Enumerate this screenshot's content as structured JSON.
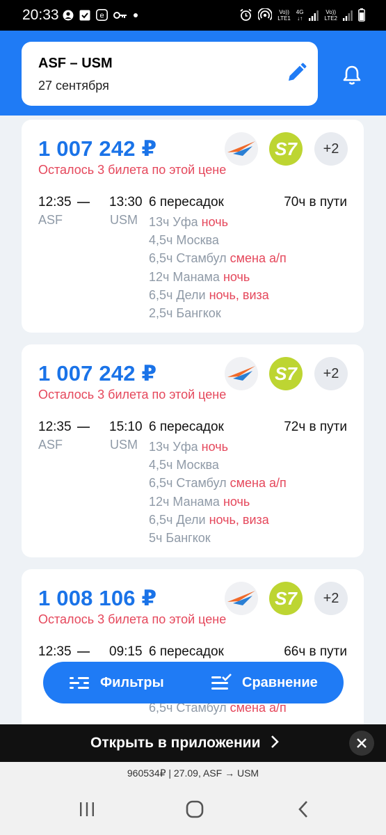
{
  "status_bar": {
    "time": "20:33",
    "network1_top": "Vo))",
    "network1_bottom": "LTE1",
    "network2_top": "4G",
    "network3_top": "Vo))",
    "network3_bottom": "LTE2"
  },
  "search": {
    "route": "ASF – USM",
    "date": "27 сентября"
  },
  "tickets": [
    {
      "price": "1 007 242 ₽",
      "availability": "Осталось 3 билета по этой цене",
      "more_airlines": "+2",
      "airline_logo": "S7",
      "depart_time": "12:35",
      "arrive_time": "13:30",
      "from": "ASF",
      "to": "USM",
      "transfers": "6 пересадок",
      "duration": "70ч в пути",
      "stops": [
        {
          "text": "13ч Уфа",
          "warning": "ночь"
        },
        {
          "text": "4,5ч Москва",
          "warning": ""
        },
        {
          "text": "6,5ч Стамбул",
          "warning": "смена а/п"
        },
        {
          "text": "12ч Манама",
          "warning": "ночь"
        },
        {
          "text": "6,5ч Дели",
          "warning": "ночь, виза"
        },
        {
          "text": "2,5ч Бангкок",
          "warning": ""
        }
      ]
    },
    {
      "price": "1 007 242 ₽",
      "availability": "Осталось 3 билета по этой цене",
      "more_airlines": "+2",
      "airline_logo": "S7",
      "depart_time": "12:35",
      "arrive_time": "15:10",
      "from": "ASF",
      "to": "USM",
      "transfers": "6 пересадок",
      "duration": "72ч в пути",
      "stops": [
        {
          "text": "13ч Уфа",
          "warning": "ночь"
        },
        {
          "text": "4,5ч Москва",
          "warning": ""
        },
        {
          "text": "6,5ч Стамбул",
          "warning": "смена а/п"
        },
        {
          "text": "12ч Манама",
          "warning": "ночь"
        },
        {
          "text": "6,5ч Дели",
          "warning": "ночь, виза"
        },
        {
          "text": "5ч Бангкок",
          "warning": ""
        }
      ]
    },
    {
      "price": "1 008 106 ₽",
      "availability": "Осталось 3 билета по этой цене",
      "more_airlines": "+2",
      "airline_logo": "S7",
      "depart_time": "12:35",
      "arrive_time": "09:15",
      "from": "",
      "to": "",
      "transfers": "6 пересадок",
      "duration": "66ч в пути",
      "stops": [
        {
          "text": "",
          "warning": ""
        },
        {
          "text": "",
          "warning": ""
        },
        {
          "text": "6,5ч Стамбул",
          "warning": "смена а/п"
        }
      ]
    }
  ],
  "actions": {
    "filters": "Фильтры",
    "compare": "Сравнение"
  },
  "banner": {
    "open_in_app": "Открыть в приложении"
  },
  "url_bar": {
    "text": "960534₽ | 27.09, ASF → USM"
  },
  "colors": {
    "brand_blue": "#1f7bf5",
    "price_blue": "#1a73e8",
    "warning_red": "#e5475b",
    "s7_green": "#bdd532"
  }
}
